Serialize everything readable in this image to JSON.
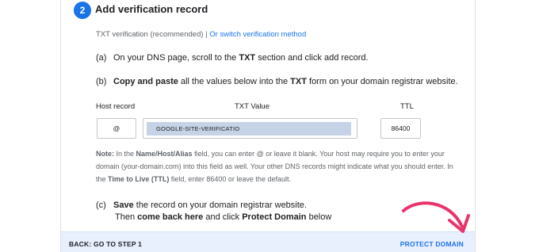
{
  "step": {
    "number": "2",
    "title": "Add verification record"
  },
  "method": {
    "current": "TXT verification (recommended)",
    "separator": "|",
    "switch_link": "Or switch verification method"
  },
  "instructions": {
    "a_letter": "(a)",
    "a_pre": "On your DNS page, scroll to the ",
    "a_bold": "TXT",
    "a_post": " section and click add record.",
    "b_letter": "(b)",
    "b_bold1": "Copy and paste",
    "b_mid": " all the values below into the ",
    "b_bold2": "TXT",
    "b_post": " form on your domain registrar website.",
    "c_letter": "(c)",
    "c_bold1": "Save",
    "c_post1": " the record on your domain registrar website.",
    "c2_pre": "Then ",
    "c2_bold1": "come back here",
    "c2_mid": " and click ",
    "c2_bold2": "Protect Domain",
    "c2_post": " below"
  },
  "table": {
    "headers": {
      "host": "Host record",
      "txt": "TXT Value",
      "ttl": "TTL"
    },
    "host_value": "@",
    "txt_value": "GOOGLE-SITE-VERIFICATIO",
    "ttl_value": "86400"
  },
  "note": {
    "label": "Note:",
    "t1": " In the ",
    "b1": "Name/Host/Alias",
    "t2": " field, you can enter @ or leave it blank. Your host may require you to enter your domain (your-domain.com) into this field as well. Your other DNS records might indicate what you should enter. In the ",
    "b2": "Time to Live (TTL)",
    "t3": " field, enter 86400 or leave the default."
  },
  "footer": {
    "back_label": "BACK: GO TO STEP 1",
    "protect_label": "PROTECT DOMAIN"
  },
  "colors": {
    "accent": "#1a73e8",
    "footer_bg": "#e8f0fe",
    "annotation_arrow": "#e8336b"
  }
}
